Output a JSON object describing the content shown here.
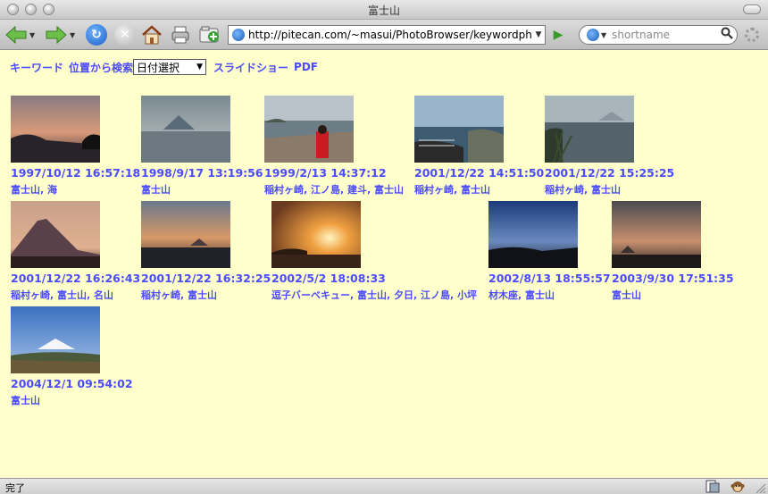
{
  "window": {
    "title": "富士山"
  },
  "toolbar": {
    "url": "http://pitecan.com/~masui/PhotoBrowser/keywordphoto",
    "search_placeholder": "shortname"
  },
  "nav": {
    "links": [
      "キーワード",
      "位置から検索"
    ],
    "select_value": "日付選択",
    "links_after": [
      "スライドショー",
      "PDF"
    ]
  },
  "photos": [
    {
      "time": "1997/10/12 16:57:18",
      "tags": [
        "富士山",
        "海"
      ]
    },
    {
      "time": "1998/9/17 13:19:56",
      "tags": [
        "富士山"
      ]
    },
    {
      "time": "1999/2/13 14:37:12",
      "tags": [
        "稲村ヶ崎",
        "江ノ島",
        "建斗",
        "富士山"
      ]
    },
    {
      "time": "2001/12/22 14:51:50",
      "tags": [
        "稲村ヶ崎",
        "富士山"
      ]
    },
    {
      "time": "2001/12/22 15:25:25",
      "tags": [
        "稲村ヶ崎",
        "富士山"
      ]
    },
    {
      "time": "2001/12/22 16:26:43",
      "tags": [
        "稲村ヶ崎",
        "富士山",
        "名山"
      ]
    },
    {
      "time": "2001/12/22 16:32:25",
      "tags": [
        "稲村ヶ崎",
        "富士山"
      ]
    },
    {
      "time": "2002/5/2 18:08:33",
      "tags": [
        "逗子バーベキュー",
        "富士山",
        "夕日",
        "江ノ島",
        "小坪"
      ]
    },
    {
      "time": "2002/8/13 18:55:57",
      "tags": [
        "材木座",
        "富士山"
      ]
    },
    {
      "time": "2003/9/30 17:51:35",
      "tags": [
        "富士山"
      ]
    },
    {
      "time": "2004/12/1 09:54:02",
      "tags": [
        "富士山"
      ]
    }
  ],
  "status": {
    "text": "完了"
  }
}
